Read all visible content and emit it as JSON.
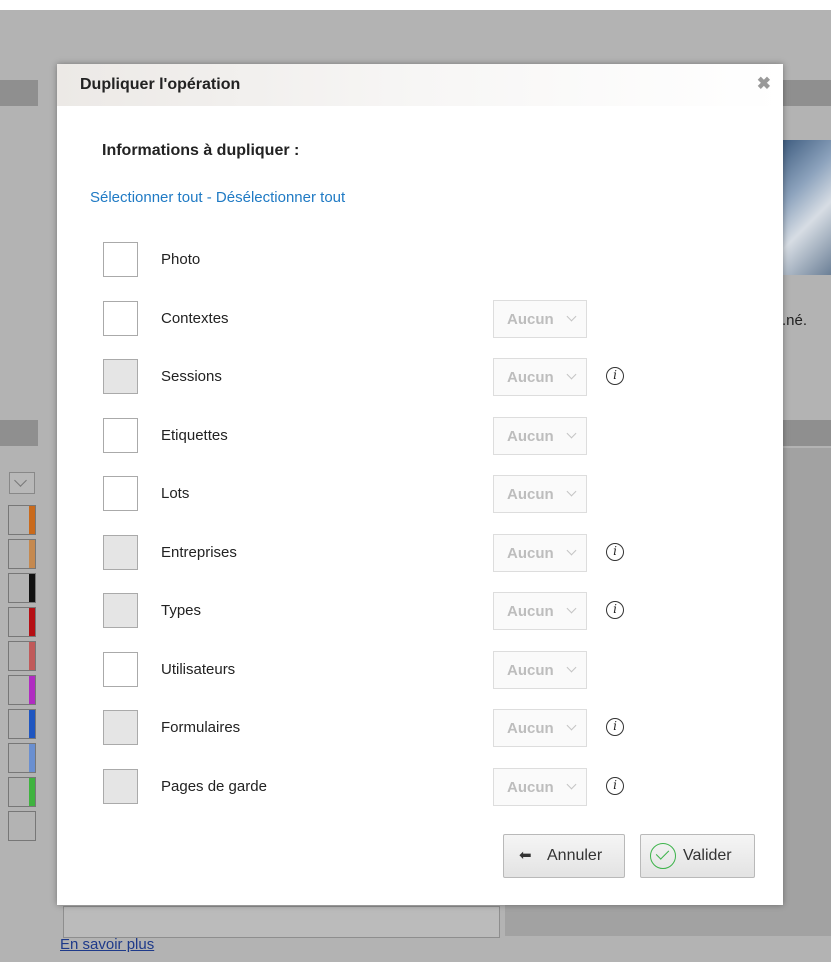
{
  "background": {
    "side_text": ".né.",
    "footer_link": "En savoir plus",
    "swatch_colors": [
      "#c96a1c",
      "#c5894f",
      "#111111",
      "#b50f14",
      "#c05a5a",
      "#b02cc1",
      "#1f56c0",
      "#6a8fd0",
      "#3fb33f",
      "#b3b3b3"
    ]
  },
  "modal": {
    "title": "Dupliquer l'opération",
    "close_symbol": "✖",
    "section_title": "Informations à dupliquer :",
    "select_all": "Sélectionner tout",
    "separator": " - ",
    "deselect_all": "Désélectionner tout",
    "items": [
      {
        "label": "Photo",
        "checkbox_state": "unchecked",
        "has_dropdown": false,
        "dropdown_value": "",
        "has_info": false
      },
      {
        "label": "Contextes",
        "checkbox_state": "unchecked",
        "has_dropdown": true,
        "dropdown_value": "Aucun",
        "has_info": false
      },
      {
        "label": "Sessions",
        "checkbox_state": "disabled",
        "has_dropdown": true,
        "dropdown_value": "Aucun",
        "has_info": true
      },
      {
        "label": "Etiquettes",
        "checkbox_state": "unchecked",
        "has_dropdown": true,
        "dropdown_value": "Aucun",
        "has_info": false
      },
      {
        "label": "Lots",
        "checkbox_state": "unchecked",
        "has_dropdown": true,
        "dropdown_value": "Aucun",
        "has_info": false
      },
      {
        "label": "Entreprises",
        "checkbox_state": "disabled",
        "has_dropdown": true,
        "dropdown_value": "Aucun",
        "has_info": true
      },
      {
        "label": "Types",
        "checkbox_state": "disabled",
        "has_dropdown": true,
        "dropdown_value": "Aucun",
        "has_info": true
      },
      {
        "label": "Utilisateurs",
        "checkbox_state": "unchecked",
        "has_dropdown": true,
        "dropdown_value": "Aucun",
        "has_info": false
      },
      {
        "label": "Formulaires",
        "checkbox_state": "disabled",
        "has_dropdown": true,
        "dropdown_value": "Aucun",
        "has_info": true
      },
      {
        "label": "Pages de garde",
        "checkbox_state": "disabled",
        "has_dropdown": true,
        "dropdown_value": "Aucun",
        "has_info": true
      }
    ],
    "info_symbol": "i",
    "cancel_label": "Annuler",
    "validate_label": "Valider"
  },
  "colors": {
    "link": "#1f7ac4",
    "validate_icon": "#3cb34a",
    "overlay": "#b3b3b3"
  }
}
